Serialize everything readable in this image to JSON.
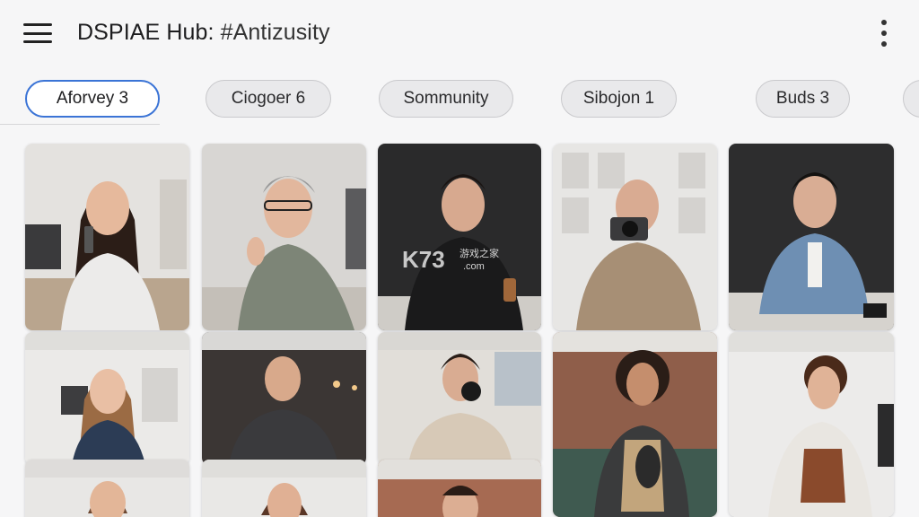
{
  "header": {
    "title": "DSPIAE Hub: ",
    "title_suffix": "#Antizusity"
  },
  "icons": {
    "menu": "menu-icon",
    "more": "more-vert-icon"
  },
  "chips": [
    {
      "label": "Aforvey 3",
      "active": true
    },
    {
      "label": "Ciogoer 6",
      "active": false
    },
    {
      "label": "Sommunity",
      "active": false
    },
    {
      "label": "Sibojon 1",
      "active": false
    },
    {
      "label": "Buds 3",
      "active": false
    }
  ],
  "watermark": {
    "text": "K73",
    "sub": "游戏之家",
    "domain": ".com"
  },
  "colors": {
    "accent": "#3b74d6",
    "background": "#f6f6f7",
    "chip_bg": "#e9e9eb"
  }
}
